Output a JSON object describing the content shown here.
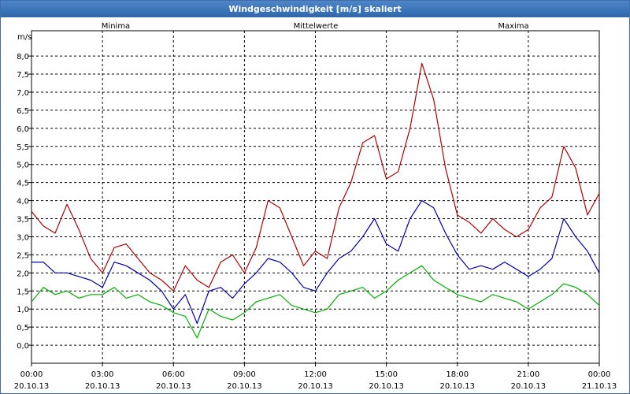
{
  "window_title": "Windgeschwindigkeit [m/s] skaliert",
  "chart_data": {
    "type": "line",
    "title": "Windgeschwindigkeit [m/s] skaliert",
    "ylabel": "m/s",
    "ylim": [
      -0.5,
      8.7
    ],
    "yticks": [
      "0,0",
      "0,5",
      "1,0",
      "1,5",
      "2,0",
      "2,5",
      "3,0",
      "3,5",
      "4,0",
      "4,5",
      "5,0",
      "5,5",
      "6,0",
      "6,5",
      "7,0",
      "7,5",
      "8,0"
    ],
    "xlim": [
      0,
      24
    ],
    "xticks": [
      {
        "x": 0,
        "time": "00:00",
        "date": "20.10.13"
      },
      {
        "x": 3,
        "time": "03:00",
        "date": "20.10.13"
      },
      {
        "x": 6,
        "time": "06:00",
        "date": "20.10.13"
      },
      {
        "x": 9,
        "time": "09:00",
        "date": "20.10.13"
      },
      {
        "x": 12,
        "time": "12:00",
        "date": "20.10.13"
      },
      {
        "x": 15,
        "time": "15:00",
        "date": "20.10.13"
      },
      {
        "x": 18,
        "time": "18:00",
        "date": "20.10.13"
      },
      {
        "x": 21,
        "time": "21:00",
        "date": "20.10.13"
      },
      {
        "x": 24,
        "time": "00:00",
        "date": "21.10.13"
      }
    ],
    "grid": true,
    "x": [
      0,
      0.5,
      1,
      1.5,
      2,
      2.5,
      3,
      3.5,
      4,
      4.5,
      5,
      5.5,
      6,
      6.5,
      7,
      7.5,
      8,
      8.5,
      9,
      9.5,
      10,
      10.5,
      11,
      11.5,
      12,
      12.5,
      13,
      13.5,
      14,
      14.5,
      15,
      15.5,
      16,
      16.5,
      17,
      17.5,
      18,
      18.5,
      19,
      19.5,
      20,
      20.5,
      21,
      21.5,
      22,
      22.5,
      23,
      23.5,
      24
    ],
    "series": [
      {
        "name": "Minima",
        "color": "#00b000",
        "values": [
          1.2,
          1.6,
          1.4,
          1.5,
          1.3,
          1.4,
          1.4,
          1.6,
          1.3,
          1.4,
          1.2,
          1.1,
          0.9,
          0.8,
          0.2,
          1.0,
          0.8,
          0.7,
          0.9,
          1.2,
          1.3,
          1.4,
          1.1,
          1.0,
          0.9,
          1.0,
          1.4,
          1.5,
          1.6,
          1.3,
          1.5,
          1.8,
          2.0,
          2.2,
          1.8,
          1.6,
          1.4,
          1.3,
          1.2,
          1.4,
          1.3,
          1.2,
          1.0,
          1.2,
          1.4,
          1.7,
          1.6,
          1.4,
          1.1
        ]
      },
      {
        "name": "Mittelwerte",
        "color": "#0000b0",
        "values": [
          2.3,
          2.3,
          2.0,
          2.0,
          1.9,
          1.8,
          1.6,
          2.3,
          2.2,
          2.0,
          1.8,
          1.5,
          1.0,
          1.4,
          0.6,
          1.5,
          1.6,
          1.3,
          1.7,
          2.0,
          2.4,
          2.3,
          2.0,
          1.6,
          1.5,
          2.0,
          2.4,
          2.6,
          3.0,
          3.5,
          2.8,
          2.6,
          3.5,
          4.0,
          3.8,
          3.1,
          2.5,
          2.1,
          2.2,
          2.1,
          2.3,
          2.1,
          1.9,
          2.1,
          2.4,
          3.5,
          3.0,
          2.6,
          2.0
        ]
      },
      {
        "name": "Maxima",
        "color": "#b00000",
        "values": [
          3.7,
          3.3,
          3.1,
          3.9,
          3.2,
          2.4,
          2.0,
          2.7,
          2.8,
          2.4,
          2.0,
          1.8,
          1.5,
          2.2,
          1.8,
          1.6,
          2.3,
          2.5,
          2.0,
          2.7,
          4.0,
          3.8,
          3.0,
          2.2,
          2.6,
          2.4,
          3.8,
          4.5,
          5.6,
          5.8,
          4.6,
          4.8,
          6.0,
          7.8,
          6.8,
          4.9,
          3.6,
          3.4,
          3.1,
          3.5,
          3.2,
          3.0,
          3.2,
          3.8,
          4.1,
          5.5,
          4.9,
          3.6,
          4.2
        ]
      }
    ]
  }
}
